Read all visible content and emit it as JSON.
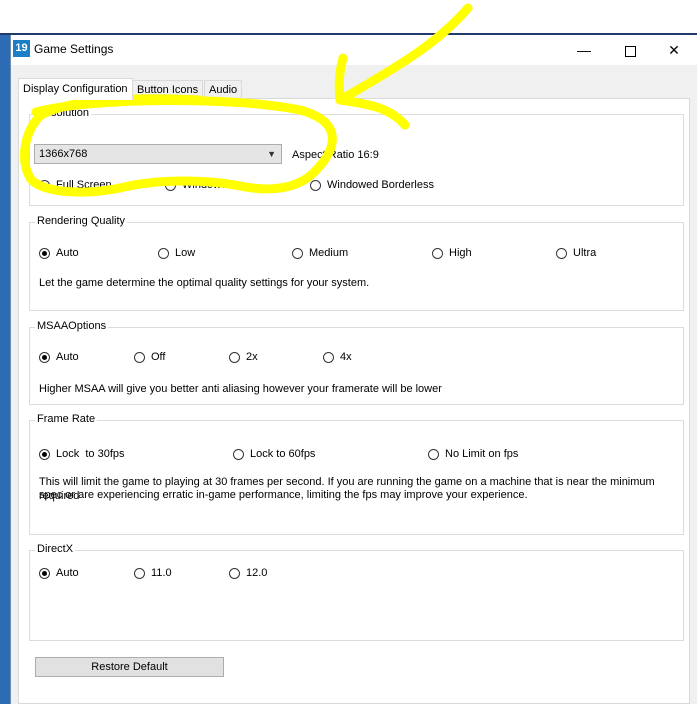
{
  "window": {
    "title": "Game Settings",
    "icon_label": "19"
  },
  "tabs": [
    {
      "label": "Display Configuration",
      "active": true
    },
    {
      "label": "Button Icons",
      "active": false
    },
    {
      "label": "Audio",
      "active": false
    }
  ],
  "resolution": {
    "label": "Resolution",
    "selected": "1366x768",
    "aspect": "Aspect Ratio 16:9",
    "options": [
      "Full Screen",
      "Windowed",
      "Windowed Borderless"
    ],
    "checked": 0
  },
  "rendering": {
    "label": "Rendering Quality",
    "options": [
      "Auto",
      "Low",
      "Medium",
      "High",
      "Ultra"
    ],
    "checked": 0,
    "description": "Let the game determine the optimal quality settings for your system."
  },
  "msaa": {
    "label": "MSAAOptions",
    "options": [
      "Auto",
      "Off",
      "2x",
      "4x"
    ],
    "checked": 0,
    "description": "Higher MSAA will give you better anti aliasing however your framerate will be lower"
  },
  "framerate": {
    "label": "Frame Rate",
    "options": [
      "Lock  to 30fps",
      "Lock to 60fps",
      "No Limit on fps"
    ],
    "checked": 0,
    "description_line1": "This will limit the game to playing at 30 frames per second. If you are running the game on a machine that is near the minimum required",
    "description_line2": "spec or are experiencing erratic in-game performance, limiting the fps may improve your experience."
  },
  "directx": {
    "label": "DirectX",
    "options": [
      "Auto",
      "11.0",
      "12.0"
    ],
    "checked": 0
  },
  "restore_button": "Restore Default",
  "colors": {
    "annotation": "#ffff00",
    "titlebar": "#ffffff",
    "panel": "#ffffff",
    "window_bg": "#f0f0f0"
  }
}
